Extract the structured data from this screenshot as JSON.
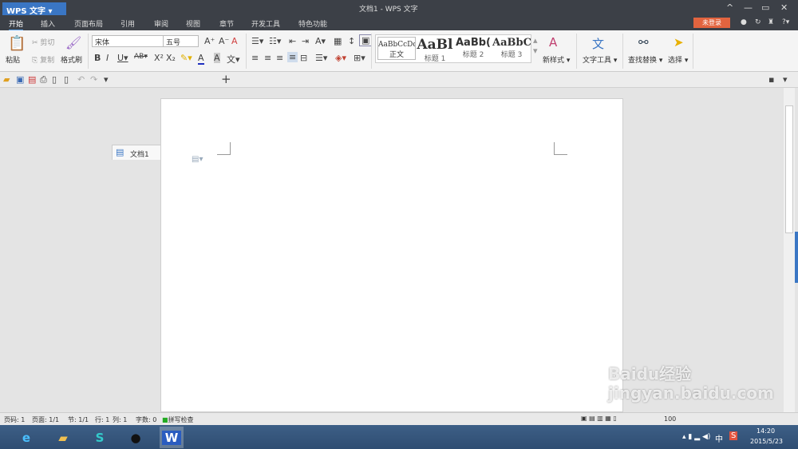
{
  "app": {
    "name": "WPS 文字",
    "title": "文档1 - WPS 文字"
  },
  "tabs": [
    "开始",
    "插入",
    "页面布局",
    "引用",
    "审阅",
    "视图",
    "章节",
    "开发工具",
    "特色功能"
  ],
  "login": "未登录",
  "ribbon": {
    "paste": "粘贴",
    "cut": "剪切",
    "copy": "复制",
    "format_painter": "格式刷",
    "font": "宋体",
    "size": "五号",
    "styles": [
      {
        "preview": "AaBbCcDd",
        "label": "正文"
      },
      {
        "preview": "AaBl",
        "label": "标题 1"
      },
      {
        "preview": "AaBb(",
        "label": "标题 2"
      },
      {
        "preview": "AaBbC",
        "label": "标题 3"
      }
    ],
    "new_style": "新样式",
    "text_tools": "文字工具",
    "find_replace": "查找替换",
    "select": "选择"
  },
  "doc_tab": "文档1",
  "status": {
    "page": "页码: 1",
    "pages": "页面: 1/1",
    "section": "节: 1/1",
    "row": "行: 1",
    "col": "列: 1",
    "words": "字数: 0",
    "spell": "拼写检查",
    "zoom": "100"
  },
  "taskbar": {
    "time": "14:20",
    "date": "2015/5/23",
    "ime": "中"
  },
  "watermark": "Baidu经验 jingyan.baidu.com",
  "colors": {
    "accent": "#3a76c4",
    "login": "#e2643f",
    "titlebar": "#3c4047"
  }
}
